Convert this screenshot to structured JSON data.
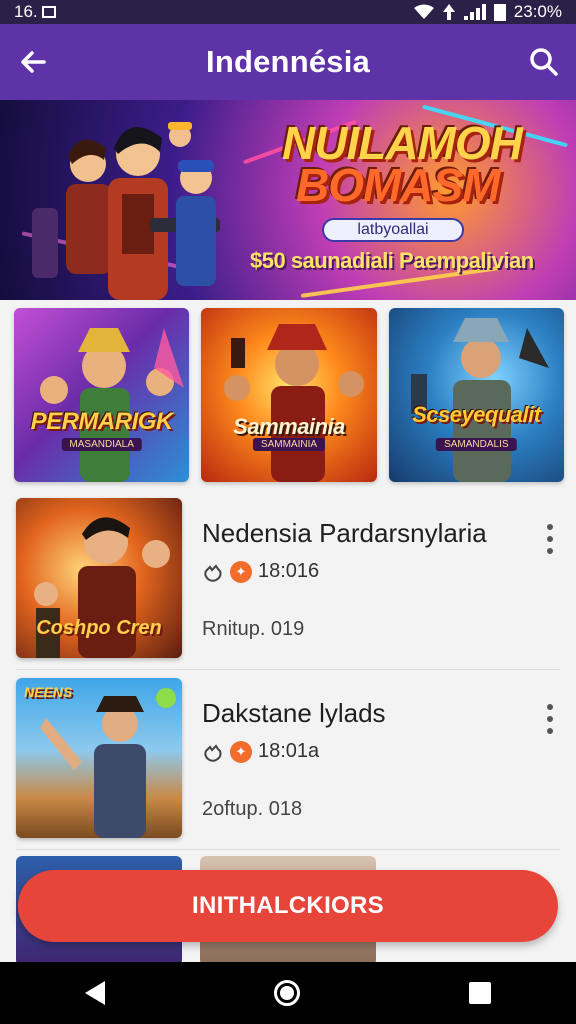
{
  "status_bar": {
    "time": "16.",
    "right_text": "23:0%"
  },
  "app_bar": {
    "title": "Indennésia",
    "back_icon": "arrow-left-icon",
    "search_icon": "search-icon"
  },
  "hero": {
    "title_line1": "NUILAMOH",
    "title_line2": "BOMASM",
    "tag": "latbyoallai",
    "subtitle": "$50 saunadiali Paempalivian"
  },
  "tiles": [
    {
      "title": "PERMARIGK",
      "subtitle": "MASANDIALA"
    },
    {
      "title": "Sammainia",
      "subtitle": "SAMMAINIA"
    },
    {
      "title": "Scseyequalit",
      "subtitle": "SAMANDALIS"
    }
  ],
  "list": [
    {
      "title": "Nedensia Pardarsnylaria",
      "meta": "18:016",
      "sub": "Rnitup. 019",
      "thumb_caption": "Coshpo Cren"
    },
    {
      "title": "Dakstane lylads",
      "meta": "18:01a",
      "sub": "2oftup. 018",
      "thumb_caption": "NEENS"
    }
  ],
  "action_button": {
    "label": "INITHALCKIORS"
  },
  "colors": {
    "app_bar": "#5e33a8",
    "action": "#e8453a",
    "badge": "#f26c2b"
  }
}
